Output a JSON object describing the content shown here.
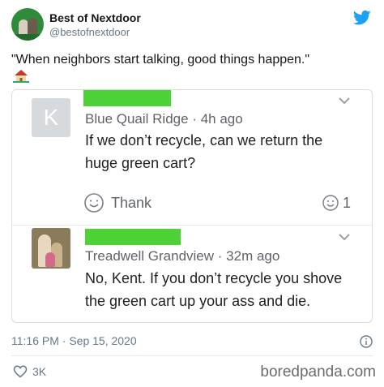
{
  "account": {
    "name": "Best of Nextdoor",
    "handle": "@bestofnextdoor"
  },
  "tweet": {
    "text": "\"When neighbors start talking, good things happen.\""
  },
  "posts": [
    {
      "avatar_letter": "K",
      "location": "Blue Quail Ridge",
      "time": "4h ago",
      "text": "If we don’t recycle, can we return the huge green cart?",
      "thank_label": "Thank",
      "reaction_count": "1"
    },
    {
      "location": "Treadwell Grandview",
      "time": "32m ago",
      "text": "No, Kent. If you don’t recycle you shove the green cart up your ass and die."
    }
  ],
  "footer": {
    "timestamp": "11:16 PM · Sep 15, 2020",
    "likes": "3K",
    "watermark": "boredpanda.com"
  },
  "colors": {
    "redaction_green": "#4cd137",
    "twitter_blue": "#1da1f2"
  },
  "icons": [
    "twitter-bird-icon",
    "house-emoji-icon",
    "chevron-down-icon",
    "smile-icon",
    "info-icon",
    "heart-icon"
  ]
}
